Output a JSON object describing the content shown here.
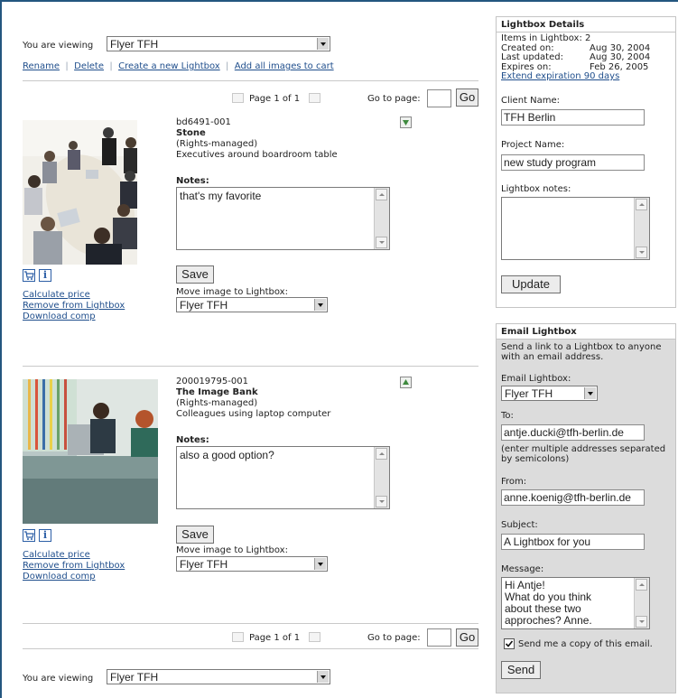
{
  "viewing": {
    "label": "You are viewing",
    "selected": "Flyer TFH"
  },
  "actions": {
    "rename": "Rename",
    "delete": "Delete",
    "create": "Create a new Lightbox",
    "add_all": "Add all images to cart"
  },
  "pager": {
    "page_text": "Page 1 of 1",
    "goto_label": "Go to page:",
    "go_label": "Go"
  },
  "images": [
    {
      "id": "bd6491-001",
      "collection": "Stone",
      "rights": "(Rights-managed)",
      "caption": "Executives around boardroom table",
      "notes_label": "Notes:",
      "notes": "that's my favorite",
      "save_label": "Save",
      "move_label": "Move image to Lightbox:",
      "move_selected": "Flyer TFH",
      "links": [
        "Calculate price",
        "Remove from Lightbox",
        "Download comp"
      ]
    },
    {
      "id": "200019795-001",
      "collection": "The Image Bank",
      "rights": "(Rights-managed)",
      "caption": "Colleagues using laptop computer",
      "notes_label": "Notes:",
      "notes": "also a good option?",
      "save_label": "Save",
      "move_label": "Move image to Lightbox:",
      "move_selected": "Flyer TFH",
      "links": [
        "Calculate price",
        "Remove from Lightbox",
        "Download comp"
      ]
    }
  ],
  "details": {
    "title": "Lightbox Details",
    "items": "Items in Lightbox: 2",
    "created_label": "Created on:",
    "created": "Aug 30, 2004",
    "updated_label": "Last updated:",
    "updated": "Aug 30, 2004",
    "expires_label": "Expires on:",
    "expires": "Feb 26, 2005",
    "extend": "Extend expiration 90 days",
    "client_label": "Client Name:",
    "client": "TFH Berlin",
    "project_label": "Project Name:",
    "project": "new study program",
    "notes_label": "Lightbox notes:",
    "update_label": "Update"
  },
  "email": {
    "title": "Email Lightbox",
    "intro": [
      "Send a link to a Lightbox to anyone",
      "with an email address."
    ],
    "lightbox_label": "Email Lightbox:",
    "lightbox": "Flyer TFH",
    "to_label": "To:",
    "to": "antje.ducki@tfh-berlin.de",
    "to_hint": [
      "(enter multiple addresses separated",
      "by semicolons)"
    ],
    "from_label": "From:",
    "from": "anne.koenig@tfh-berlin.de",
    "subject_label": "Subject:",
    "subject": "A Lightbox for you",
    "message_label": "Message:",
    "message": [
      "Hi Antje!",
      "What do you think",
      "about these two",
      "approches? Anne."
    ],
    "copy_label": "Send me a copy of this email.",
    "send_label": "Send"
  },
  "colors": {
    "accent": "#1f4e8c",
    "frame": "#24567f",
    "panel_gray": "#dcdcdc"
  }
}
